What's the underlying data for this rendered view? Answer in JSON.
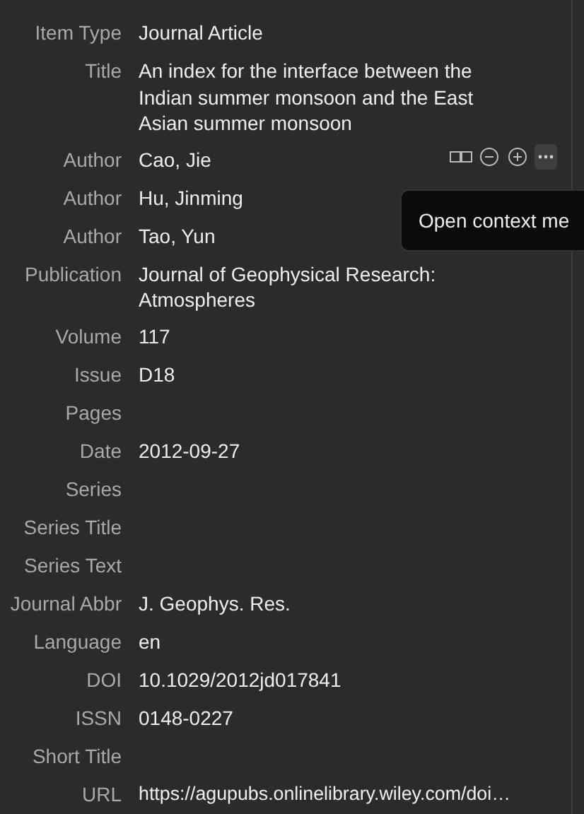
{
  "fields": [
    {
      "label": "Item Type",
      "value": "Journal Article",
      "kind": "text"
    },
    {
      "label": "Title",
      "value": "An index for the interface between the Indian summer monsoon and the East Asian summer monsoon",
      "kind": "text"
    },
    {
      "label": "Author",
      "value": "Cao, Jie",
      "kind": "author",
      "hovered": true
    },
    {
      "label": "Author",
      "value": "Hu, Jinming",
      "kind": "author"
    },
    {
      "label": "Author",
      "value": "Tao, Yun",
      "kind": "author"
    },
    {
      "label": "Publication",
      "value": "Journal of Geophysical Research: Atmospheres",
      "kind": "text"
    },
    {
      "label": "Volume",
      "value": "117",
      "kind": "text"
    },
    {
      "label": "Issue",
      "value": "D18",
      "kind": "text"
    },
    {
      "label": "Pages",
      "kind": "text"
    },
    {
      "label": "Date",
      "value": "2012-09-27",
      "kind": "text"
    },
    {
      "label": "Series",
      "kind": "text"
    },
    {
      "label": "Series Title",
      "kind": "text"
    },
    {
      "label": "Series Text",
      "kind": "text"
    },
    {
      "label": "Journal Abbr",
      "value": "J. Geophys. Res.",
      "kind": "text"
    },
    {
      "label": "Language",
      "value": "en",
      "kind": "text"
    },
    {
      "label": "DOI",
      "value": "10.1029/2012jd017841",
      "kind": "text"
    },
    {
      "label": "ISSN",
      "value": "0148-0227",
      "kind": "text"
    },
    {
      "label": "Short Title",
      "kind": "text"
    },
    {
      "label": "URL",
      "value": "https://agupubs.onlinelibrary.wiley.com/doi…",
      "kind": "text"
    }
  ],
  "tooltip": {
    "text": "Open context me"
  }
}
